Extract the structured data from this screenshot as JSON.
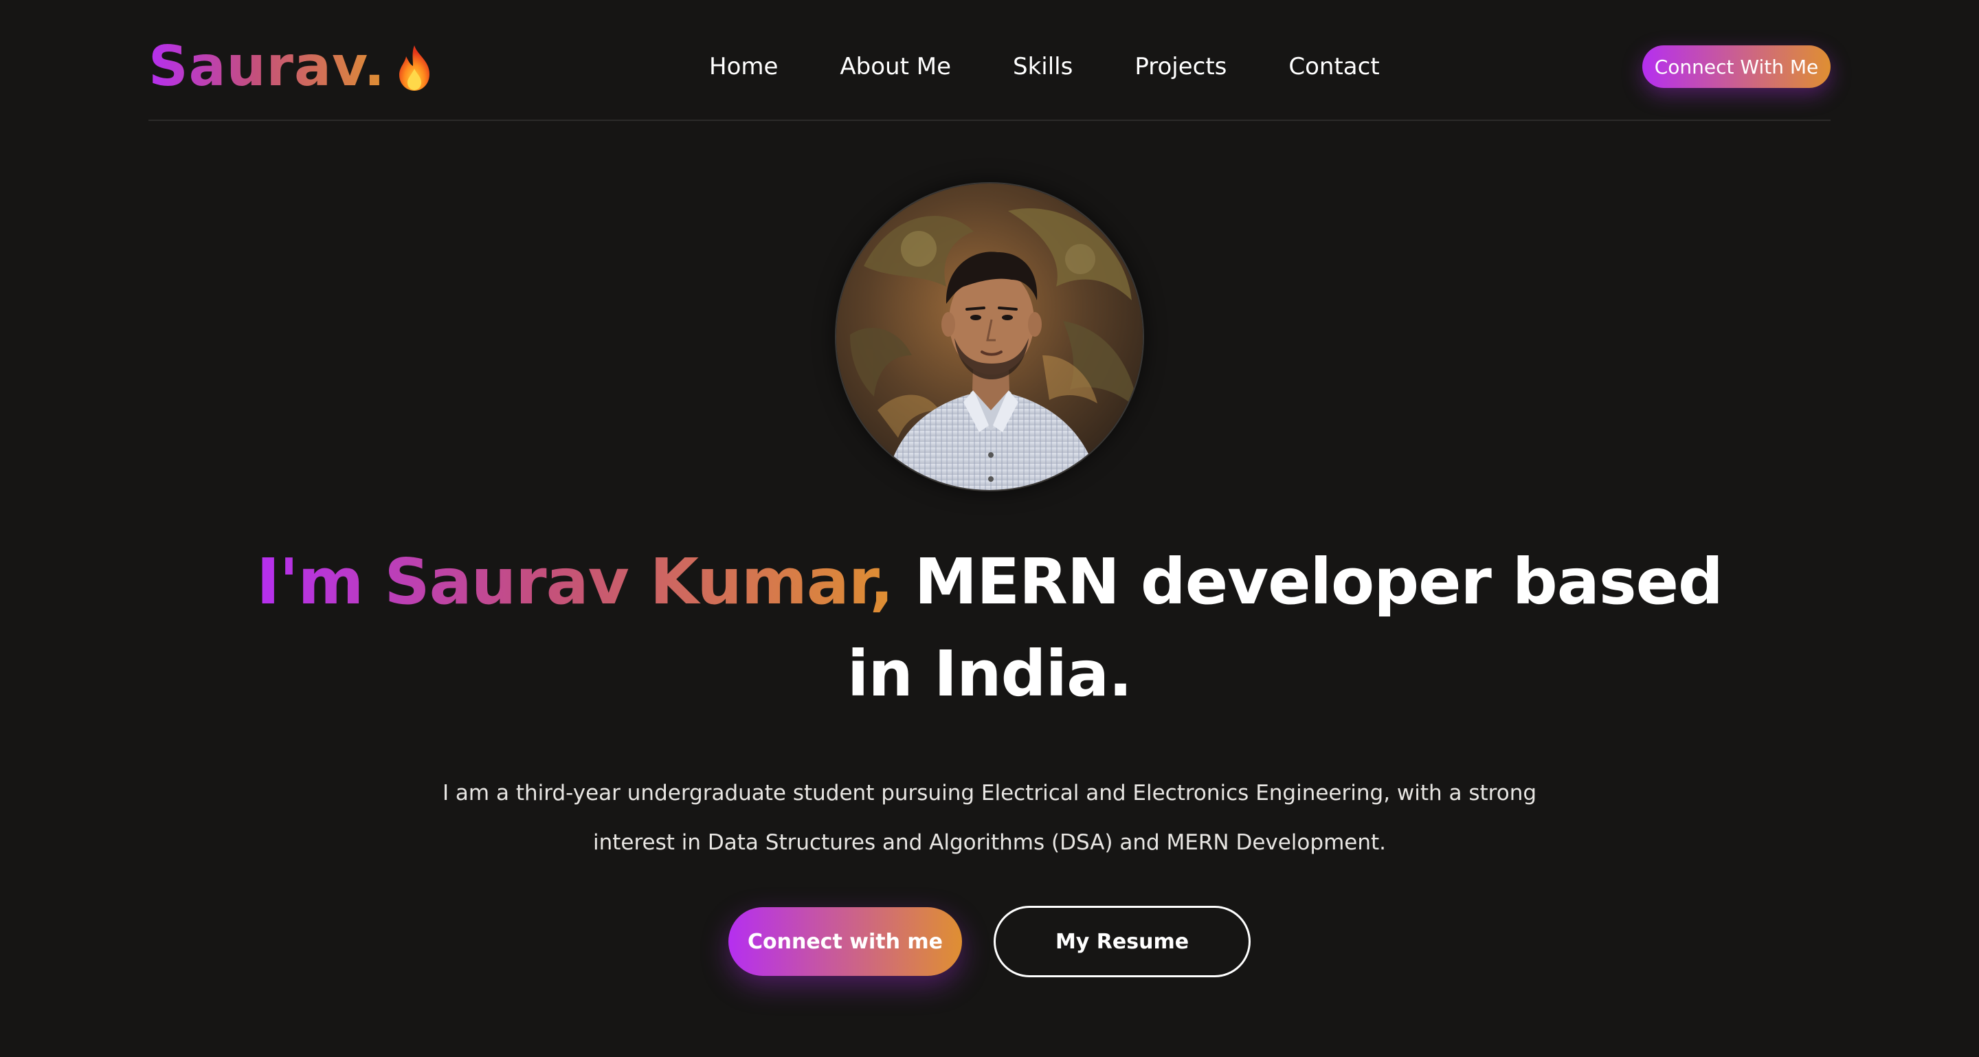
{
  "brand": {
    "logo_text": "Saurav.",
    "logo_icon": "flame-icon"
  },
  "nav": {
    "items": [
      {
        "label": "Home"
      },
      {
        "label": "About Me"
      },
      {
        "label": "Skills"
      },
      {
        "label": "Projects"
      },
      {
        "label": "Contact"
      }
    ],
    "cta_label": "Connect With Me"
  },
  "hero": {
    "avatar_alt": "profile-photo",
    "headline_highlight": "I'm Saurav Kumar,",
    "headline_rest": " MERN developer based in India.",
    "description": "I am a third-year undergraduate student pursuing Electrical and Electronics Engineering, with a strong interest in Data Structures and Algorithms (DSA) and MERN Development.",
    "primary_button": "Connect with me",
    "secondary_button": "My Resume"
  },
  "colors": {
    "background": "#161514",
    "gradient_start": "#b52ff0",
    "gradient_end": "#df8f32",
    "text": "#ffffff"
  }
}
